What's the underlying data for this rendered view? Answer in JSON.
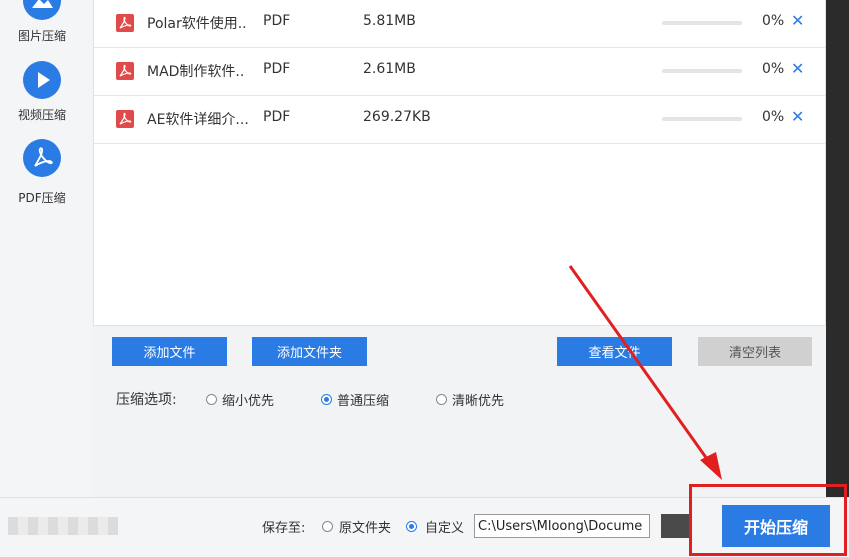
{
  "sidebar": {
    "items": [
      {
        "label": "图片压缩",
        "icon": "image-icon"
      },
      {
        "label": "视频压缩",
        "icon": "play-icon"
      },
      {
        "label": "PDF压缩",
        "icon": "pdf-icon"
      }
    ]
  },
  "files": [
    {
      "name": "Polar软件使用..",
      "type": "PDF",
      "size": "5.81MB",
      "progress": 0,
      "percent": "0%"
    },
    {
      "name": "MAD制作软件..",
      "type": "PDF",
      "size": "2.61MB",
      "progress": 0,
      "percent": "0%"
    },
    {
      "name": "AE软件详细介...",
      "type": "PDF",
      "size": "269.27KB",
      "progress": 0,
      "percent": "0%"
    }
  ],
  "toolbar": {
    "add_file": "添加文件",
    "add_folder": "添加文件夹",
    "view_file": "查看文件",
    "clear_list": "清空列表"
  },
  "options": {
    "label": "压缩选项:",
    "choices": [
      {
        "label": "缩小优先",
        "selected": false
      },
      {
        "label": "普通压缩",
        "selected": true
      },
      {
        "label": "清晰优先",
        "selected": false
      }
    ]
  },
  "footer": {
    "save_label": "保存至:",
    "original_folder": "原文件夹",
    "custom": "自定义",
    "path_value": "C:\\Users\\Mloong\\Docume",
    "start_button": "开始压缩"
  },
  "colors": {
    "accent": "#2b7be4",
    "pdf_red": "#e04a4a",
    "annotation_red": "#e02020"
  }
}
